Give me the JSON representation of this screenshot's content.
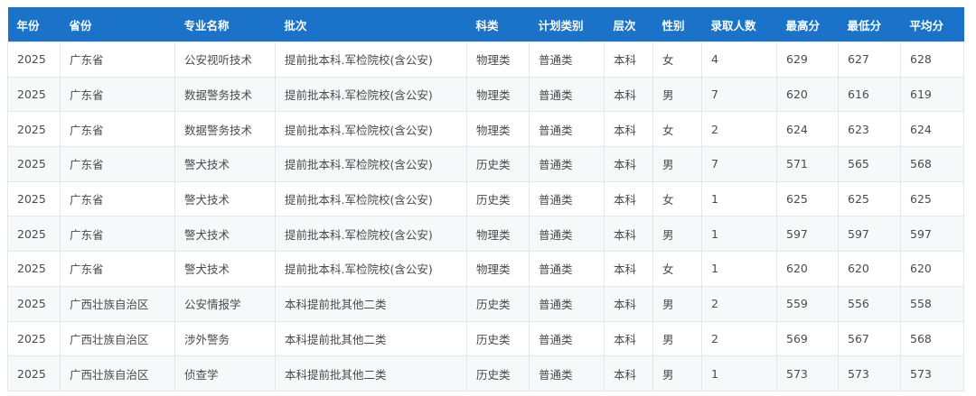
{
  "table": {
    "columns": [
      "年份",
      "省份",
      "专业名称",
      "批次",
      "科类",
      "计划类别",
      "层次",
      "性别",
      "录取人数",
      "最高分",
      "最低分",
      "平均分"
    ],
    "rows": [
      [
        "2025",
        "广东省",
        "公安视听技术",
        "提前批本科.军检院校(含公安)",
        "物理类",
        "普通类",
        "本科",
        "女",
        "4",
        "629",
        "627",
        "628"
      ],
      [
        "2025",
        "广东省",
        "数据警务技术",
        "提前批本科.军检院校(含公安)",
        "物理类",
        "普通类",
        "本科",
        "男",
        "7",
        "620",
        "616",
        "619"
      ],
      [
        "2025",
        "广东省",
        "数据警务技术",
        "提前批本科.军检院校(含公安)",
        "物理类",
        "普通类",
        "本科",
        "女",
        "2",
        "624",
        "623",
        "624"
      ],
      [
        "2025",
        "广东省",
        "警犬技术",
        "提前批本科.军检院校(含公安)",
        "历史类",
        "普通类",
        "本科",
        "男",
        "7",
        "571",
        "565",
        "568"
      ],
      [
        "2025",
        "广东省",
        "警犬技术",
        "提前批本科.军检院校(含公安)",
        "历史类",
        "普通类",
        "本科",
        "女",
        "1",
        "625",
        "625",
        "625"
      ],
      [
        "2025",
        "广东省",
        "警犬技术",
        "提前批本科.军检院校(含公安)",
        "物理类",
        "普通类",
        "本科",
        "男",
        "1",
        "597",
        "597",
        "597"
      ],
      [
        "2025",
        "广东省",
        "警犬技术",
        "提前批本科.军检院校(含公安)",
        "物理类",
        "普通类",
        "本科",
        "女",
        "1",
        "620",
        "620",
        "620"
      ],
      [
        "2025",
        "广西壮族自治区",
        "公安情报学",
        "本科提前批其他二类",
        "历史类",
        "普通类",
        "本科",
        "男",
        "2",
        "559",
        "556",
        "558"
      ],
      [
        "2025",
        "广西壮族自治区",
        "涉外警务",
        "本科提前批其他二类",
        "历史类",
        "普通类",
        "本科",
        "男",
        "2",
        "569",
        "567",
        "568"
      ],
      [
        "2025",
        "广西壮族自治区",
        "侦查学",
        "本科提前批其他二类",
        "历史类",
        "普通类",
        "本科",
        "男",
        "1",
        "573",
        "573",
        "573"
      ]
    ]
  }
}
